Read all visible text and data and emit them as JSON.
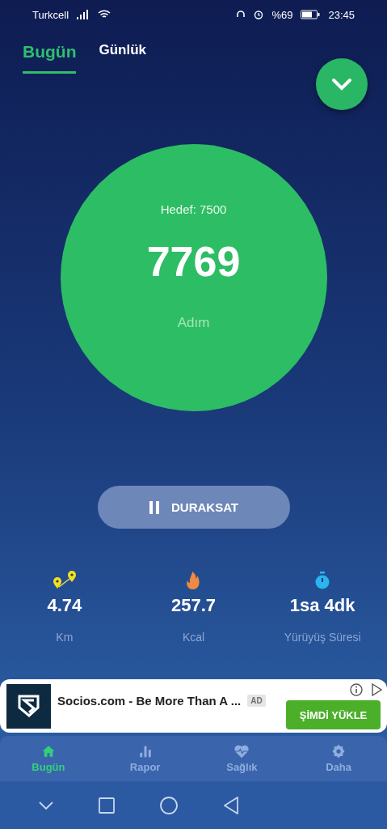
{
  "status_bar": {
    "carrier": "Turkcell",
    "battery": "%69",
    "time": "23:45"
  },
  "tabs": [
    {
      "label": "Bugün",
      "selected": true
    },
    {
      "label": "Günlük",
      "selected": false
    }
  ],
  "goal": {
    "label": "Hedef: 7500",
    "steps": "7769",
    "unit": "Adım"
  },
  "pause_button": {
    "label": "DURAKSAT"
  },
  "stats": [
    {
      "kind": "distance",
      "value": "4.74",
      "label": "Km"
    },
    {
      "kind": "calories",
      "value": "257.7",
      "label": "Kcal"
    },
    {
      "kind": "time",
      "value": "1sa 4dk",
      "label": "Yürüyüş Süresi"
    }
  ],
  "ad": {
    "title": "Socios.com - Be More Than A ...",
    "badge": "AD",
    "button": "ŞİMDİ YÜKLE"
  },
  "bottom_nav": [
    {
      "kind": "home",
      "label": "Bugün",
      "selected": true
    },
    {
      "kind": "report",
      "label": "Rapor",
      "selected": false
    },
    {
      "kind": "health",
      "label": "Sağlık",
      "selected": false
    },
    {
      "kind": "more",
      "label": "Daha",
      "selected": false
    }
  ]
}
